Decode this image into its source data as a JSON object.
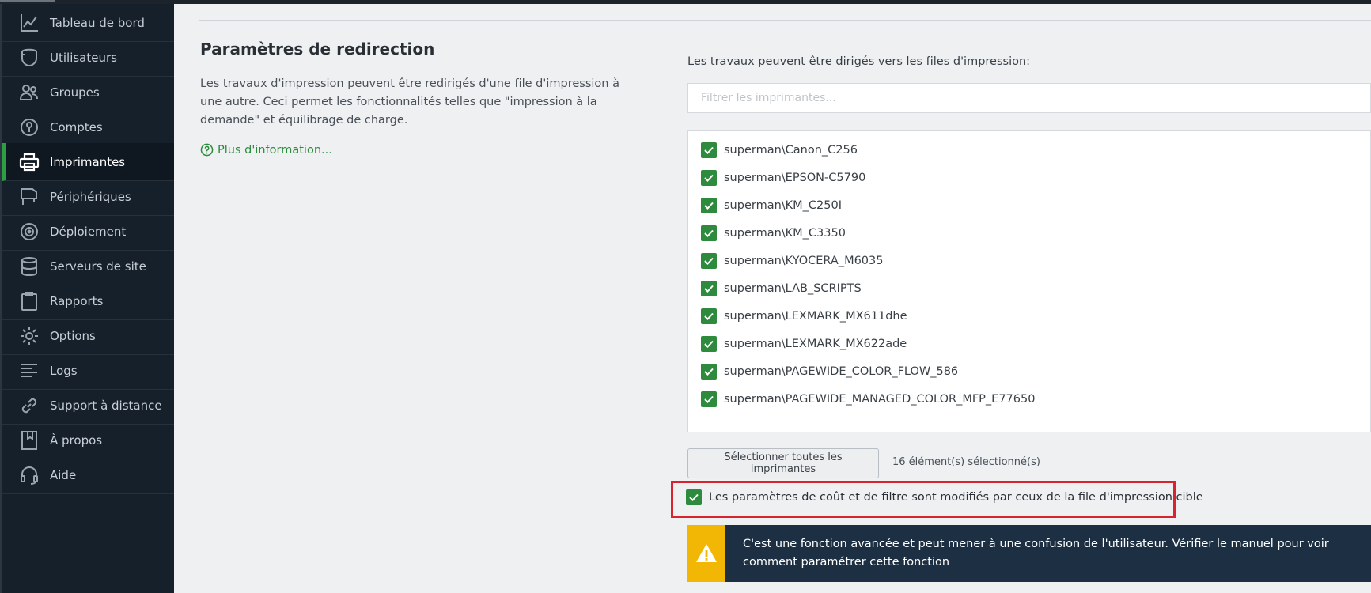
{
  "sidebar": {
    "items": [
      {
        "label": "Tableau de bord",
        "icon": "chart-line-icon"
      },
      {
        "label": "Utilisateurs",
        "icon": "user-icon"
      },
      {
        "label": "Groupes",
        "icon": "users-icon"
      },
      {
        "label": "Comptes",
        "icon": "account-lock-icon"
      },
      {
        "label": "Imprimantes",
        "icon": "printer-icon",
        "active": true
      },
      {
        "label": "Périphériques",
        "icon": "device-icon"
      },
      {
        "label": "Déploiement",
        "icon": "deployment-icon"
      },
      {
        "label": "Serveurs de site",
        "icon": "database-icon"
      },
      {
        "label": "Rapports",
        "icon": "clipboard-icon"
      },
      {
        "label": "Options",
        "icon": "gear-icon"
      },
      {
        "label": "Logs",
        "icon": "list-icon"
      },
      {
        "label": "Support à distance",
        "icon": "link-icon"
      },
      {
        "label": "À propos",
        "icon": "book-icon"
      },
      {
        "label": "Aide",
        "icon": "headset-icon"
      }
    ]
  },
  "section": {
    "title": "Paramètres de redirection",
    "description": "Les travaux d'impression peuvent être redirigés d'une file d'impression à une autre. Ceci permet les fonctionnalités telles que \"impression à la demande\" et équilibrage de charge.",
    "more_info": "Plus d'information..."
  },
  "redirect": {
    "label": "Les travaux peuvent être dirigés vers les files d'impression:",
    "filter_placeholder": "Filtrer les imprimantes...",
    "printers": [
      {
        "name": "superman\\Canon_C256",
        "checked": true
      },
      {
        "name": "superman\\EPSON-C5790",
        "checked": true
      },
      {
        "name": "superman\\KM_C250I",
        "checked": true
      },
      {
        "name": "superman\\KM_C3350",
        "checked": true
      },
      {
        "name": "superman\\KYOCERA_M6035",
        "checked": true
      },
      {
        "name": "superman\\LAB_SCRIPTS",
        "checked": true
      },
      {
        "name": "superman\\LEXMARK_MX611dhe",
        "checked": true
      },
      {
        "name": "superman\\LEXMARK_MX622ade",
        "checked": true
      },
      {
        "name": "superman\\PAGEWIDE_COLOR_FLOW_586",
        "checked": true
      },
      {
        "name": "superman\\PAGEWIDE_MANAGED_COLOR_MFP_E77650",
        "checked": true
      }
    ],
    "select_all_label": "Sélectionner toutes les imprimantes",
    "selected_count": "16 élément(s) sélectionné(s)"
  },
  "cost_filter": {
    "label": "Les paramètres de coût et de filtre sont modifiés par ceux de la file d'impression cible",
    "checked": true
  },
  "warning": {
    "text": "C'est une fonction avancée et peut mener à une confusion de l'utilisateur. Vérifier le manuel pour voir comment paramétrer cette fonction",
    "icon": "warning-icon"
  },
  "colors": {
    "sidebar_bg": "#15202b",
    "accent_green": "#2e8b3e",
    "warning_yellow": "#f2b705",
    "warning_bg": "#1d2f42",
    "highlight_red": "#d9232e"
  }
}
